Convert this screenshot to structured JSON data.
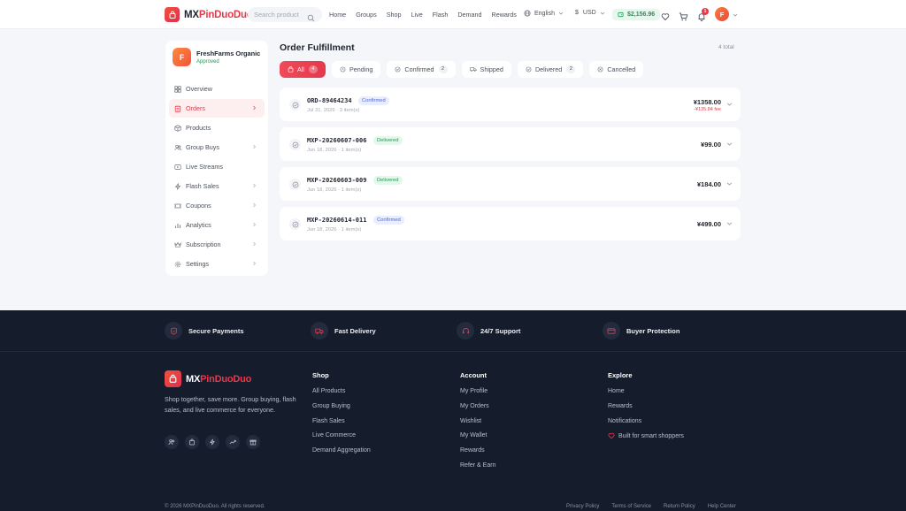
{
  "header": {
    "brand_a": "MX",
    "brand_b": "PinDuoDuo",
    "search_placeholder": "Search product",
    "nav": [
      "Home",
      "Groups",
      "Shop",
      "Live",
      "Flash",
      "Demand",
      "Rewards"
    ],
    "language": "English",
    "currency_symbol": "$",
    "currency": "USD",
    "wallet_balance": "$2,156.96",
    "notification_count": "1",
    "user_initial": "F"
  },
  "sidebar": {
    "store_initial": "F",
    "store_name": "FreshFarms Organic",
    "store_status": "Approved",
    "items": [
      {
        "label": "Overview",
        "icon": "grid-icon",
        "arrow": false,
        "active": false
      },
      {
        "label": "Orders",
        "icon": "clipboard-icon",
        "arrow": true,
        "active": true
      },
      {
        "label": "Products",
        "icon": "box-icon",
        "arrow": false,
        "active": false
      },
      {
        "label": "Group Buys",
        "icon": "users-icon",
        "arrow": true,
        "active": false
      },
      {
        "label": "Live Streams",
        "icon": "video-icon",
        "arrow": false,
        "active": false
      },
      {
        "label": "Flash Sales",
        "icon": "lightning-icon",
        "arrow": true,
        "active": false
      },
      {
        "label": "Coupons",
        "icon": "ticket-icon",
        "arrow": true,
        "active": false
      },
      {
        "label": "Analytics",
        "icon": "bar-chart-icon",
        "arrow": true,
        "active": false
      },
      {
        "label": "Subscription",
        "icon": "crown-icon",
        "arrow": true,
        "active": false
      },
      {
        "label": "Settings",
        "icon": "gear-icon",
        "arrow": true,
        "active": false
      }
    ]
  },
  "main": {
    "title": "Order Fulfillment",
    "total": "4 total",
    "tabs": [
      {
        "label": "All",
        "count": "4",
        "active": true
      },
      {
        "label": "Pending",
        "count": "",
        "active": false
      },
      {
        "label": "Confirmed",
        "count": "2",
        "active": false
      },
      {
        "label": "Shipped",
        "count": "",
        "active": false
      },
      {
        "label": "Delivered",
        "count": "2",
        "active": false
      },
      {
        "label": "Cancelled",
        "count": "",
        "active": false
      }
    ],
    "orders": [
      {
        "id": "ORD-89464234",
        "status": "Confirmed",
        "status_type": "confirmed",
        "date": "Jul 31, 2026 · 3 item(s)",
        "price": "¥1358.00",
        "fee": "-¥135.84 fee"
      },
      {
        "id": "MXP-20260607-006",
        "status": "Delivered",
        "status_type": "delivered",
        "date": "Jun 18, 2026 · 1 item(s)",
        "price": "¥99.00",
        "fee": ""
      },
      {
        "id": "MXP-20260603-009",
        "status": "Delivered",
        "status_type": "delivered",
        "date": "Jun 18, 2026 · 1 item(s)",
        "price": "¥184.00",
        "fee": ""
      },
      {
        "id": "MXP-20260614-011",
        "status": "Confirmed",
        "status_type": "confirmed",
        "date": "Jun 18, 2026 · 1 item(s)",
        "price": "¥499.00",
        "fee": ""
      }
    ]
  },
  "features": [
    "Secure Payments",
    "Fast Delivery",
    "24/7 Support",
    "Buyer Protection"
  ],
  "footer": {
    "brand_a": "MX",
    "brand_b": "PinDuoDuo",
    "description": "Shop together, save more. Group buying, flash sales, and live commerce for everyone.",
    "columns": [
      {
        "heading": "Shop",
        "links": [
          "All Products",
          "Group Buying",
          "Flash Sales",
          "Live Commerce",
          "Demand Aggregation"
        ]
      },
      {
        "heading": "Account",
        "links": [
          "My Profile",
          "My Orders",
          "Wishlist",
          "My Wallet",
          "Rewards",
          "Refer & Earn"
        ]
      },
      {
        "heading": "Explore",
        "links": [
          "Home",
          "Rewards",
          "Notifications"
        ]
      }
    ],
    "built_with": "Built for smart shoppers",
    "copyright": "© 2026 MXPinDuoDuo. All rights reserved.",
    "legal": [
      "Privacy Policy",
      "Terms of Service",
      "Return Policy",
      "Help Center"
    ]
  },
  "colors": {
    "accent": "#e5394c",
    "footer_bg": "#151c2c",
    "success": "#1d9a54",
    "info": "#4f6bd8"
  }
}
